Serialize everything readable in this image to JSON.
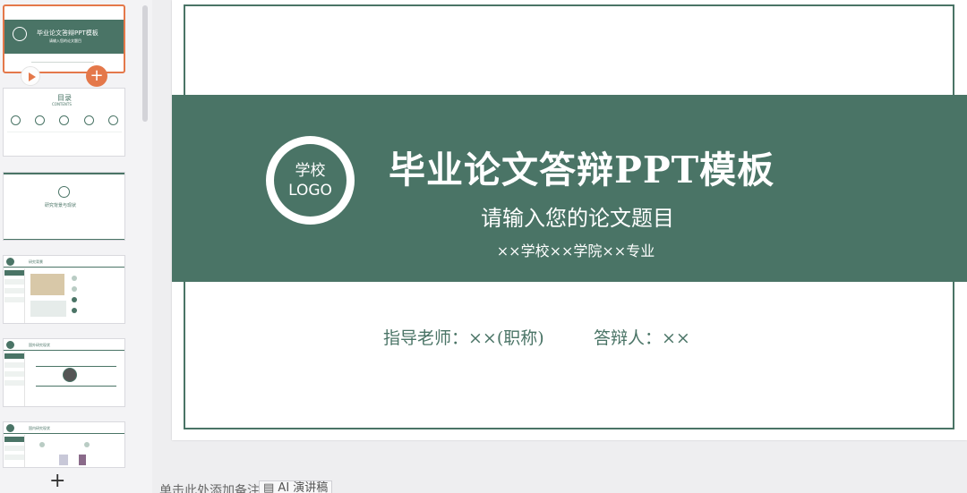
{
  "slide": {
    "logo_line1": "学校",
    "logo_line2": "LOGO",
    "title": "毕业论文答辩PPT模板",
    "subtitle": "请输入您的论文题目",
    "school_line": "××学校××学院××专业",
    "advisor": "指导老师：××(职称)",
    "defender": "答辩人：××"
  },
  "thumbnails": {
    "t1_title": "毕业论文答辩PPT模板",
    "t1_sub": "请输入您的论文题目",
    "t2_title": "目录",
    "t2_sub": "CONTENTS",
    "t3_title": "研究背景与现状",
    "t4_title": "研究背景",
    "t5_title": "国外研究现状",
    "t6_title": "国内研究现状"
  },
  "panel": {
    "add_slide_label": "+",
    "insert_label": "+"
  },
  "notes": {
    "hint": "单击此处添加备注",
    "ai_button": "AI 演讲稿"
  },
  "colors": {
    "theme_green": "#4a7466",
    "accent_orange": "#e4784a"
  }
}
